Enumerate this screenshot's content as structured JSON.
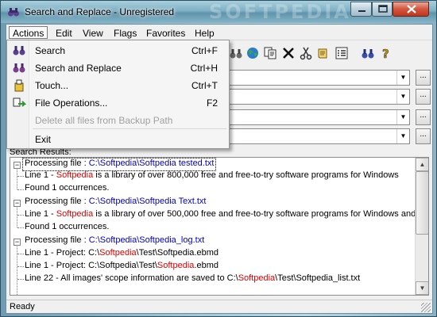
{
  "window": {
    "title": "Search and Replace - Unregistered",
    "watermark": "SOFTPEDIA"
  },
  "menubar": [
    "Actions",
    "Edit",
    "View",
    "Flags",
    "Favorites",
    "Help"
  ],
  "actions_menu": {
    "items": [
      {
        "label": "Search",
        "shortcut": "Ctrl+F",
        "icon": "binoculars-icon",
        "enabled": true
      },
      {
        "label": "Search and Replace",
        "shortcut": "Ctrl+H",
        "icon": "binoculars-replace-icon",
        "enabled": true
      },
      {
        "label": "Touch...",
        "shortcut": "Ctrl+T",
        "icon": "touch-icon",
        "enabled": true
      },
      {
        "label": "File Operations...",
        "shortcut": "F2",
        "icon": "file-operations-icon",
        "enabled": true
      },
      {
        "label": "Delete all files from Backup Path",
        "shortcut": "",
        "icon": "",
        "enabled": false
      },
      {
        "label": "Exit",
        "shortcut": "",
        "icon": "",
        "enabled": true
      }
    ]
  },
  "results": {
    "label": "Search Results:",
    "groups": [
      {
        "header_prefix": "Processing file : ",
        "file": "C:\\Softpedia\\Softpedia tested.txt",
        "lines": [
          {
            "prefix": "Line   1 - ",
            "match": "Softpedia",
            "suffix": " is a library of over 800,000 free and free-to-try software programs for Windows"
          },
          {
            "text": "Found 1 occurrences."
          }
        ]
      },
      {
        "header_prefix": "Processing file : ",
        "file": "C:\\Softpedia\\Softpedia Text.txt",
        "lines": [
          {
            "prefix": "Line   1 - ",
            "match": "Softpedia",
            "suffix": " is a library of over 500,000 free and free-to-try software programs for Windows and Lin"
          },
          {
            "text": "Found 1 occurrences."
          }
        ]
      },
      {
        "header_prefix": "Processing file : ",
        "file": "C:\\Softpedia\\Softpedia_log.txt",
        "lines": [
          {
            "prefix": "Line   1 - Project: C:\\",
            "match": "Softpedia",
            "mid": "\\Test\\Softpedia.ebmd"
          },
          {
            "prefix": "Line   1 - Project: C:\\Softpedia\\Test\\",
            "match": "Softpedia",
            "suffix": ".ebmd"
          },
          {
            "prefix": "Line  22 - All images' scope information are saved to C:\\",
            "match": "Softpedia",
            "suffix": "\\Test\\Softpedia_list.txt"
          }
        ]
      }
    ]
  },
  "status": {
    "text": "Ready"
  }
}
